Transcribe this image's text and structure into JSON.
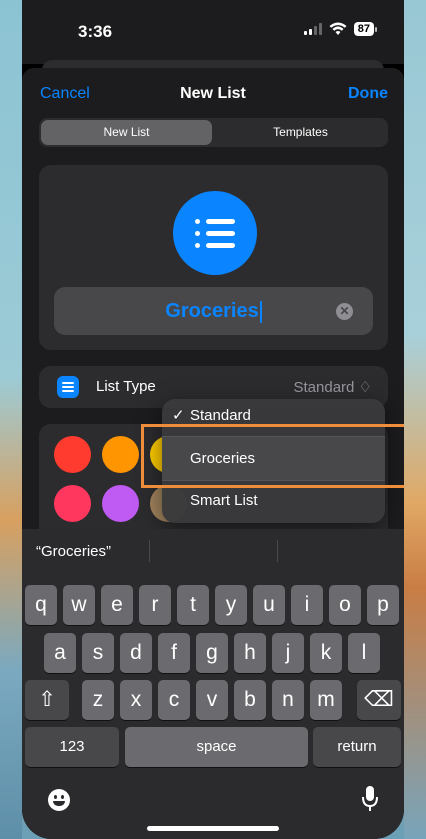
{
  "status": {
    "time": "3:36",
    "battery": "87"
  },
  "nav": {
    "cancel": "Cancel",
    "title": "New List",
    "done": "Done"
  },
  "segments": [
    "New List",
    "Templates"
  ],
  "list_name": "Groceries",
  "list_type": {
    "label": "List Type",
    "value": "Standard ♢"
  },
  "menu": {
    "check": "✓",
    "items": [
      "Standard",
      "Groceries",
      "Smart List"
    ]
  },
  "colors": [
    "#ff3b30",
    "#ff9500",
    "#ffcc00",
    "#ff375f",
    "#bf5af2",
    "#a2845e"
  ],
  "keyboard": {
    "suggestion": "“Groceries”",
    "row1": [
      "q",
      "w",
      "e",
      "r",
      "t",
      "y",
      "u",
      "i",
      "o",
      "p"
    ],
    "row2": [
      "a",
      "s",
      "d",
      "f",
      "g",
      "h",
      "j",
      "k",
      "l"
    ],
    "row3": [
      "z",
      "x",
      "c",
      "v",
      "b",
      "n",
      "m"
    ],
    "shift": "⇧",
    "backspace": "⌫",
    "numbers": "123",
    "space": "space",
    "return": "return"
  }
}
